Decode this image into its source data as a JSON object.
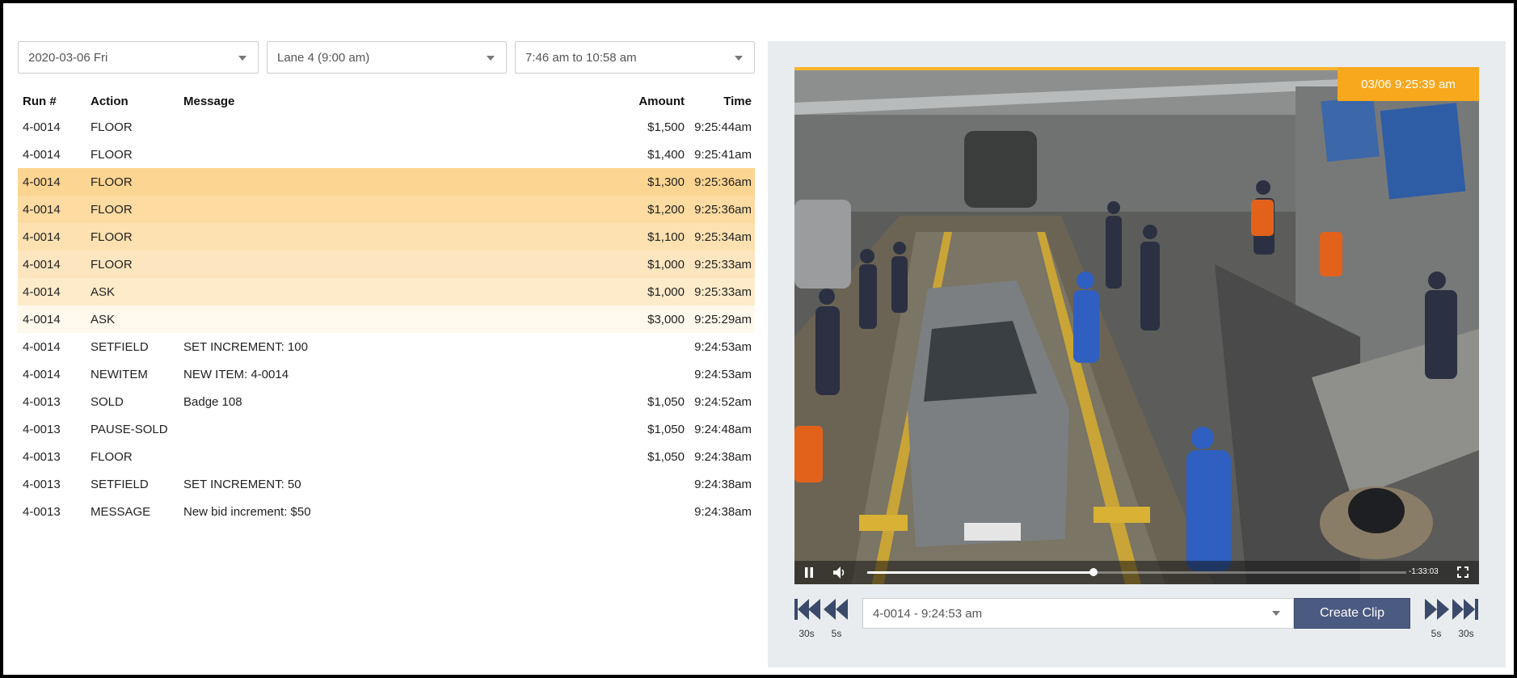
{
  "filters": {
    "date": "2020-03-06 Fri",
    "lane": "Lane 4 (9:00 am)",
    "time_range": "7:46 am to 10:58 am"
  },
  "table": {
    "headers": {
      "run": "Run #",
      "action": "Action",
      "message": "Message",
      "amount": "Amount",
      "time": "Time"
    },
    "rows": [
      {
        "run": "4-0014",
        "action": "FLOOR",
        "message": "",
        "amount": "$1,500",
        "time": "9:25:44am",
        "highlight": "#ffffff"
      },
      {
        "run": "4-0014",
        "action": "FLOOR",
        "message": "",
        "amount": "$1,400",
        "time": "9:25:41am",
        "highlight": "#ffffff"
      },
      {
        "run": "4-0014",
        "action": "FLOOR",
        "message": "",
        "amount": "$1,300",
        "time": "9:25:36am",
        "highlight": "#fcd592"
      },
      {
        "run": "4-0014",
        "action": "FLOOR",
        "message": "",
        "amount": "$1,200",
        "time": "9:25:36am",
        "highlight": "#fddba1"
      },
      {
        "run": "4-0014",
        "action": "FLOOR",
        "message": "",
        "amount": "$1,100",
        "time": "9:25:34am",
        "highlight": "#fde1b0"
      },
      {
        "run": "4-0014",
        "action": "FLOOR",
        "message": "",
        "amount": "$1,000",
        "time": "9:25:33am",
        "highlight": "#fde6bf"
      },
      {
        "run": "4-0014",
        "action": "ASK",
        "message": "",
        "amount": "$1,000",
        "time": "9:25:33am",
        "highlight": "#feebc9"
      },
      {
        "run": "4-0014",
        "action": "ASK",
        "message": "",
        "amount": "$3,000",
        "time": "9:25:29am",
        "highlight": "#fff8ec"
      },
      {
        "run": "4-0014",
        "action": "SETFIELD",
        "message": "SET INCREMENT: 100",
        "amount": "",
        "time": "9:24:53am",
        "highlight": "#ffffff"
      },
      {
        "run": "4-0014",
        "action": "NEWITEM",
        "message": "NEW ITEM: 4-0014",
        "amount": "",
        "time": "9:24:53am",
        "highlight": "#ffffff"
      },
      {
        "run": "4-0013",
        "action": "SOLD",
        "message": "Badge 108",
        "amount": "$1,050",
        "time": "9:24:52am",
        "highlight": "#ffffff"
      },
      {
        "run": "4-0013",
        "action": "PAUSE-SOLD",
        "message": "",
        "amount": "$1,050",
        "time": "9:24:48am",
        "highlight": "#ffffff"
      },
      {
        "run": "4-0013",
        "action": "FLOOR",
        "message": "",
        "amount": "$1,050",
        "time": "9:24:38am",
        "highlight": "#ffffff"
      },
      {
        "run": "4-0013",
        "action": "SETFIELD",
        "message": "SET INCREMENT: 50",
        "amount": "",
        "time": "9:24:38am",
        "highlight": "#ffffff"
      },
      {
        "run": "4-0013",
        "action": "MESSAGE",
        "message": "New bid increment: $50",
        "amount": "",
        "time": "9:24:38am",
        "highlight": "#ffffff"
      }
    ]
  },
  "video": {
    "timestamp": "03/06 9:25:39 am",
    "remaining": "-1:33:03",
    "progress": 0.42,
    "play_icon": "pause-icon",
    "volume_icon": "volume-icon",
    "fullscreen_icon": "fullscreen-icon"
  },
  "transport": {
    "back_30_label": "30s",
    "back_5_label": "5s",
    "forward_5_label": "5s",
    "forward_30_label": "30s",
    "clip_select_value": "4-0014 - 9:24:53 am",
    "create_clip_label": "Create Clip"
  },
  "colors": {
    "accent": "#f7a81c",
    "button": "#4b5a80",
    "panel": "#e9ecef"
  }
}
